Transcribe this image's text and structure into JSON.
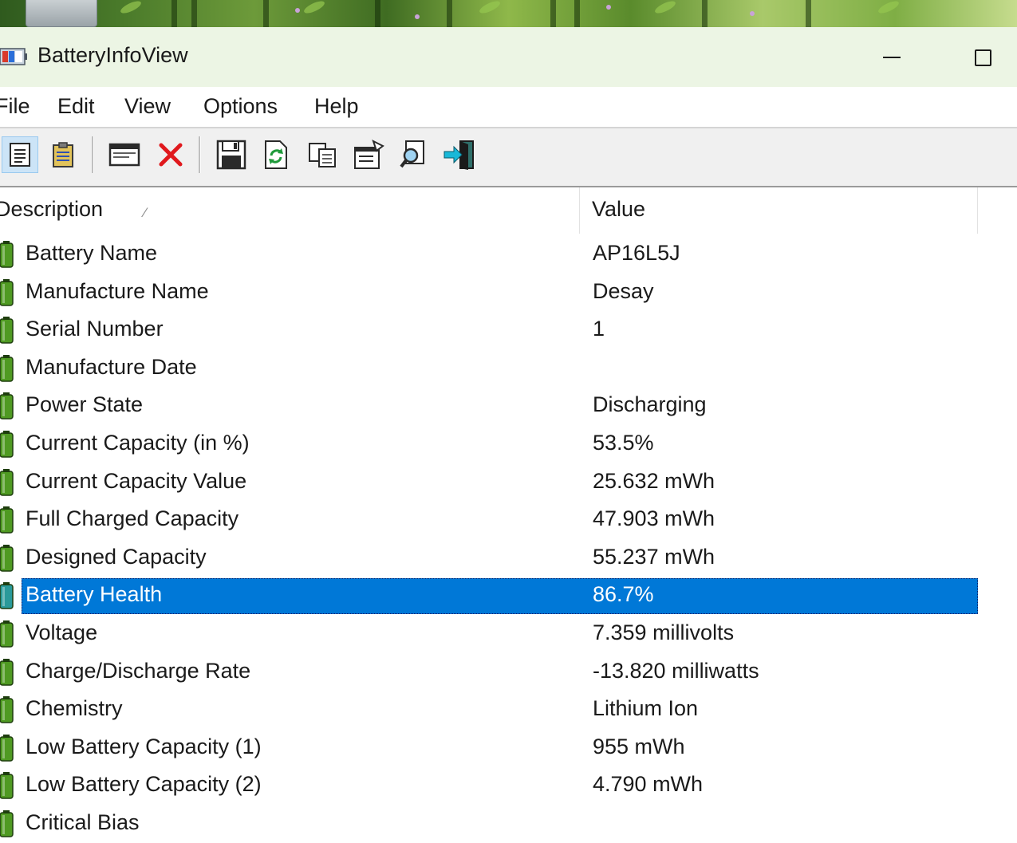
{
  "window": {
    "title": "BatteryInfoView"
  },
  "menu": [
    "File",
    "Edit",
    "View",
    "Options",
    "Help"
  ],
  "toolbar": [
    {
      "name": "properties-list-icon"
    },
    {
      "name": "clipboard-icon"
    },
    {
      "name": "window-icon"
    },
    {
      "name": "delete-icon"
    },
    {
      "name": "save-icon"
    },
    {
      "name": "refresh-icon"
    },
    {
      "name": "copy-icon"
    },
    {
      "name": "options-icon"
    },
    {
      "name": "find-icon"
    },
    {
      "name": "exit-icon"
    }
  ],
  "columns": {
    "description": "Description",
    "value": "Value"
  },
  "rows": [
    {
      "description": "Battery Name",
      "value": "AP16L5J"
    },
    {
      "description": "Manufacture Name",
      "value": "Desay"
    },
    {
      "description": "Serial Number",
      "value": "1"
    },
    {
      "description": "Manufacture Date",
      "value": ""
    },
    {
      "description": "Power State",
      "value": "Discharging"
    },
    {
      "description": "Current Capacity (in %)",
      "value": "53.5%"
    },
    {
      "description": "Current Capacity Value",
      "value": "25.632 mWh"
    },
    {
      "description": "Full Charged Capacity",
      "value": "47.903 mWh"
    },
    {
      "description": "Designed Capacity",
      "value": "55.237 mWh"
    },
    {
      "description": "Battery Health",
      "value": "86.7%",
      "selected": true
    },
    {
      "description": "Voltage",
      "value": "7.359 millivolts"
    },
    {
      "description": "Charge/Discharge Rate",
      "value": "-13.820 milliwatts"
    },
    {
      "description": "Chemistry",
      "value": "Lithium Ion"
    },
    {
      "description": "Low Battery Capacity (1)",
      "value": "955 mWh"
    },
    {
      "description": "Low Battery Capacity (2)",
      "value": "4.790 mWh"
    },
    {
      "description": "Critical Bias",
      "value": ""
    }
  ],
  "colors": {
    "selection": "#0078d7",
    "titlebar": "#ecf5e4",
    "battery_green": "#4f9a22"
  }
}
